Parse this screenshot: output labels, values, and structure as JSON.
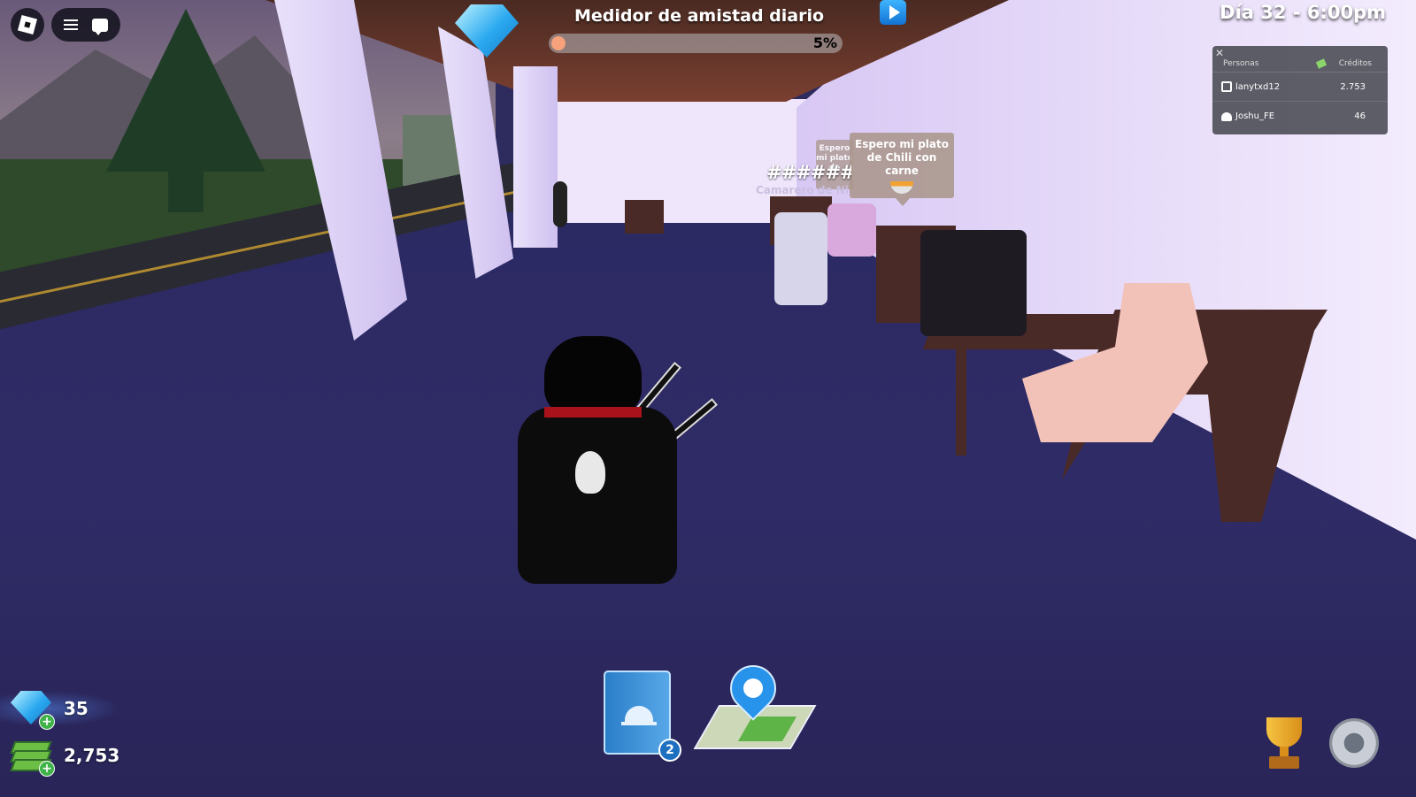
{
  "topbar": {
    "roblox_menu_icon": "roblox-logo-icon",
    "menu_icon": "hamburger-menu-icon",
    "chat_icon": "chat-icon"
  },
  "friendship_meter": {
    "title": "Medidor de amistad diario",
    "percent_label": "5%",
    "progress_fraction": 0.05,
    "gem_icon": "diamond-gem-icon",
    "play_icon": "play-button-icon"
  },
  "clock": {
    "label": "Día 32 - 6:00pm"
  },
  "leaderboard": {
    "close_icon": "close-icon",
    "col_people": "Personas",
    "col_credits": "Créditos",
    "rows": [
      {
        "name": "lanytxd12",
        "credits": "2.753",
        "icon": "premium-icon"
      },
      {
        "name": "Joshu_FE",
        "credits": "46",
        "icon": "friends-icon"
      }
    ]
  },
  "scene": {
    "speech_bubble_main": "Espero mi plato de Chili con carne",
    "speech_bubble_back": "Espero mi plato de",
    "food_icon": "chili-bowl-icon",
    "npc_hash_name": "######",
    "npc_title": "Camarero de Niv"
  },
  "currency": {
    "gems": "35",
    "cash": "2,753"
  },
  "bottom_bar": {
    "menu_book_badge": "2",
    "menu_book_icon": "serving-bell-book-icon",
    "map_icon": "map-pin-icon",
    "trophy_icon": "trophy-icon",
    "settings_icon": "gear-icon"
  },
  "colors": {
    "meter_fill": "#f7a27a",
    "gem_blue": "#2ba9f0",
    "badge_blue": "#1d6fc0",
    "plus_green": "#3fb34a"
  }
}
